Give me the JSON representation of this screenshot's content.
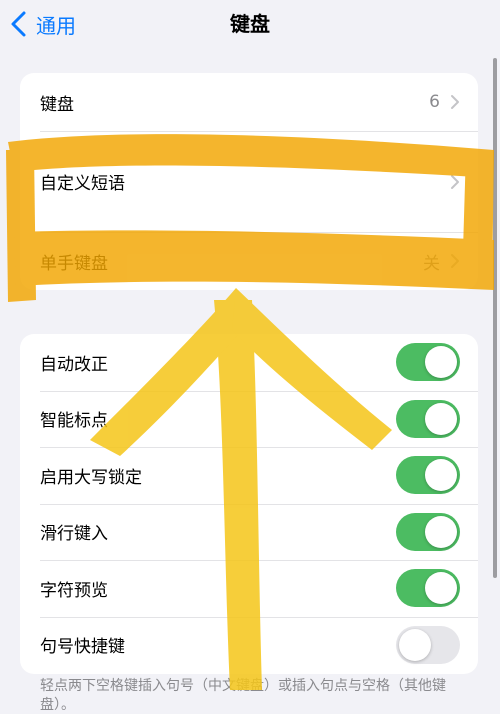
{
  "nav": {
    "back_label": "通用",
    "title": "键盘"
  },
  "group1": [
    {
      "label": "键盘",
      "value": "6"
    },
    {
      "label": "自定义短语",
      "value": ""
    },
    {
      "label": "单手键盘",
      "value": "关"
    }
  ],
  "group2": [
    {
      "label": "自动改正",
      "on": true
    },
    {
      "label": "智能标点",
      "on": true
    },
    {
      "label": "启用大写锁定",
      "on": true
    },
    {
      "label": "滑行键入",
      "on": true
    },
    {
      "label": "字符预览",
      "on": true
    },
    {
      "label": "句号快捷键",
      "on": false
    }
  ],
  "footnote": "轻点两下空格键插入句号（中文键盘）或插入句点与空格（其他键盘）。",
  "colors": {
    "accent": "#0a7aff",
    "toggle_on": "#4cbc62",
    "annotation_orange": "#f2a600",
    "annotation_yellow": "#f5c518"
  }
}
